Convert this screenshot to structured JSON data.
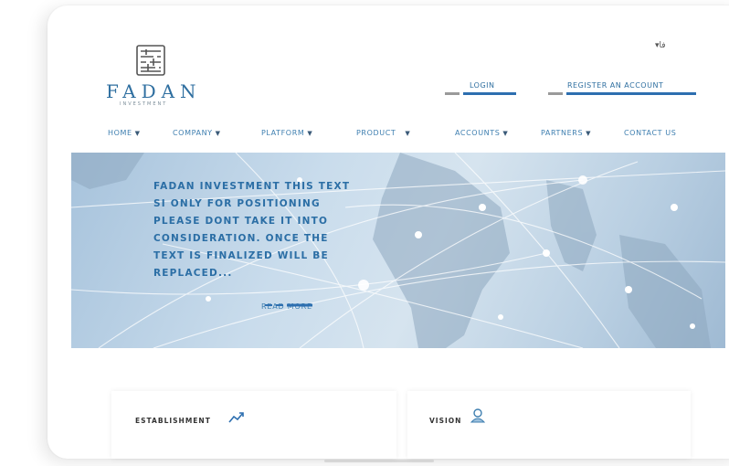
{
  "brand": {
    "name": "FADAN",
    "sub": "INVESTMENT"
  },
  "header": {
    "language": "▾فا",
    "login_label": "Login",
    "register_label": "Register an account"
  },
  "nav": {
    "items": [
      {
        "label": "Home",
        "has_caret": true
      },
      {
        "label": "Company",
        "has_caret": true
      },
      {
        "label": "Platform",
        "has_caret": true
      },
      {
        "label": "Product",
        "has_caret": true
      },
      {
        "label": "Accounts",
        "has_caret": true
      },
      {
        "label": "Partners",
        "has_caret": true
      },
      {
        "label": "Contact us",
        "has_caret": false
      }
    ],
    "caret": "▼"
  },
  "hero": {
    "lines": [
      "Fadan Investment this text",
      "si only for positioning",
      "please dont take it into",
      "consideration. once the",
      "text is finalized will be",
      "replaced..."
    ],
    "read_more": "Read More"
  },
  "cards": [
    {
      "title": "Establishment",
      "icon": "trend-icon"
    },
    {
      "title": "Vision",
      "icon": "vision-icon"
    }
  ],
  "colors": {
    "brand_blue": "#2f6fa0",
    "link_blue": "#3f7fb0",
    "accent_bar": "#2d6fb0",
    "gray_bar": "#9a9a9a"
  }
}
